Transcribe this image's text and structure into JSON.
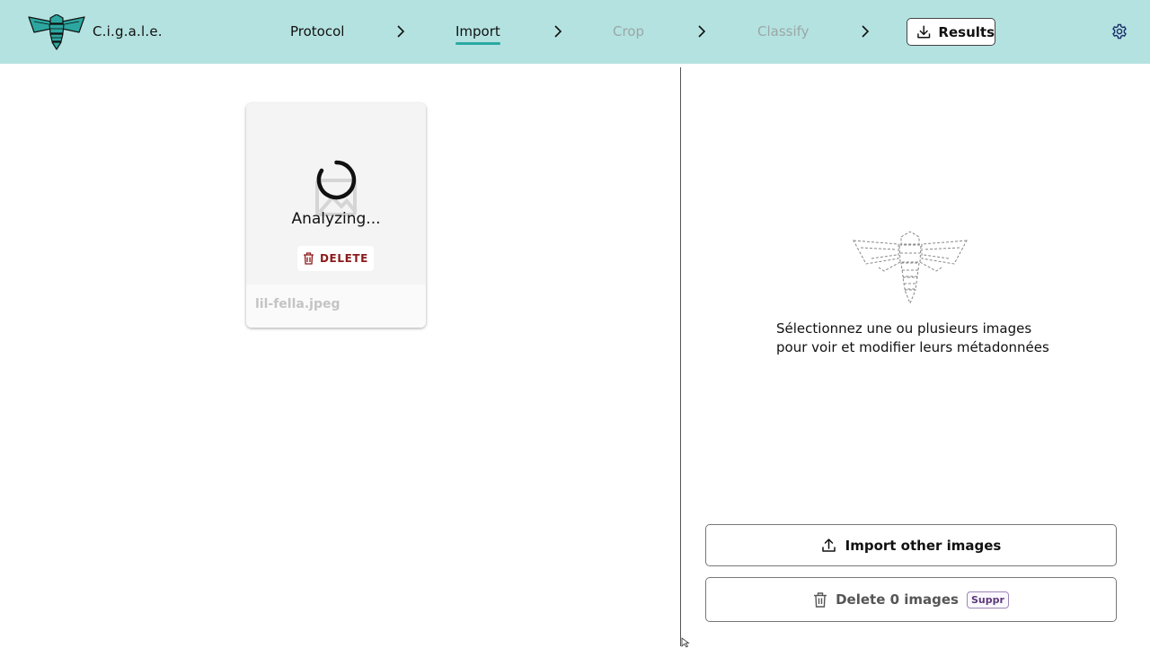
{
  "app": {
    "name": "C.i.g.a.l.e."
  },
  "nav": {
    "steps": [
      {
        "label": "Protocol",
        "state": "enabled"
      },
      {
        "label": "Import",
        "state": "active"
      },
      {
        "label": "Crop",
        "state": "disabled"
      },
      {
        "label": "Classify",
        "state": "disabled"
      }
    ],
    "results_label": "Results"
  },
  "card": {
    "status": "Analyzing...",
    "delete_label": "DELETE",
    "filename": "lil-fella.jpeg"
  },
  "sidebar": {
    "hint_line1": "Sélectionnez une ou plusieurs images",
    "hint_line2": "pour voir et modifier leurs métadonnées",
    "import_label": "Import other images",
    "delete_label": "Delete 0 images",
    "delete_shortcut": "Suppr"
  },
  "colors": {
    "header_bg": "#b4e2e0",
    "accent": "#2aa9a2",
    "danger": "#8b1a1a",
    "shortcut": "#5a3a7a"
  }
}
